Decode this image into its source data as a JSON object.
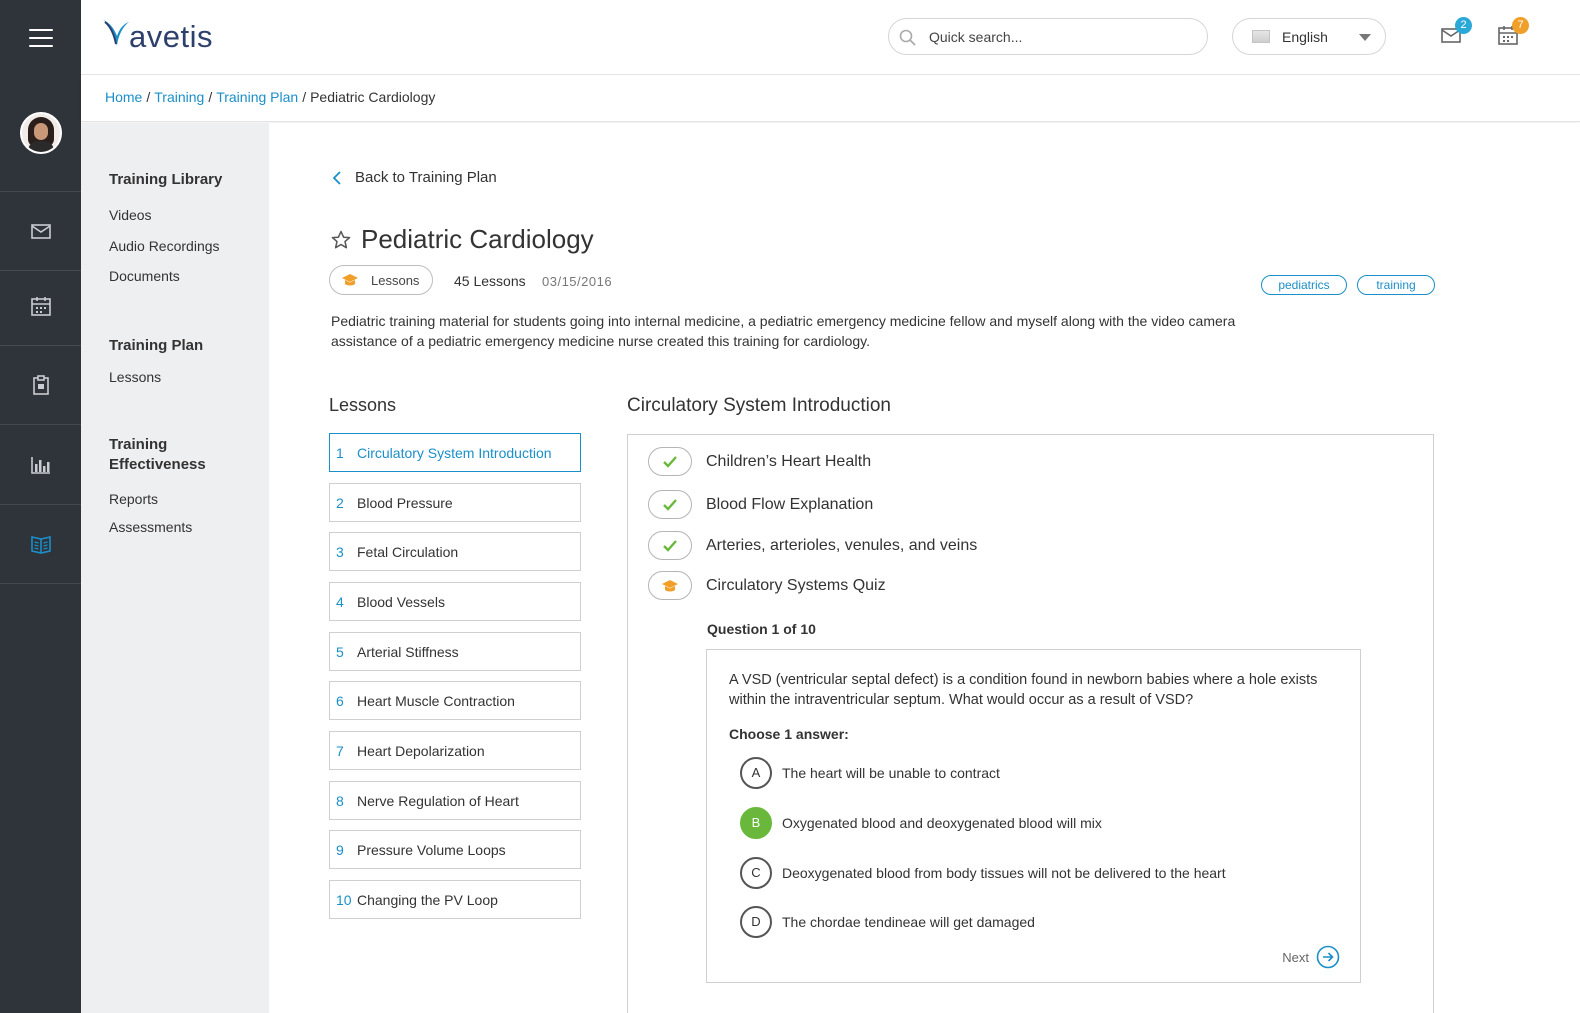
{
  "app": {
    "logo_text": "avetis",
    "accent_color": "#1a8fc9",
    "rail_color": "#2f343a"
  },
  "header": {
    "search_placeholder": "Quick search...",
    "language": "English",
    "mail_badge": "2",
    "calendar_badge": "7",
    "mail_badge_color": "#2aa8d8",
    "calendar_badge_color": "#f0a02a"
  },
  "rail": {
    "items": [
      "mail-icon",
      "calendar-icon",
      "clipboard-icon",
      "bar-chart-icon",
      "book-icon"
    ]
  },
  "breadcrumb": {
    "items": [
      "Home",
      "Training",
      "Training Plan"
    ],
    "current": "Pediatric Cardiology"
  },
  "sidebar": {
    "sections": [
      {
        "title": "Training Library",
        "links": [
          "Videos",
          "Audio Recordings",
          "Documents"
        ]
      },
      {
        "title": "Training Plan",
        "links": [
          "Lessons"
        ]
      },
      {
        "title_line1": "Training",
        "title_line2": "Effectiveness",
        "links": [
          "Reports",
          "Assessments"
        ]
      }
    ]
  },
  "course": {
    "back_label": "Back to Training Plan",
    "title": "Pediatric Cardiology",
    "type_label": "Lessons",
    "lesson_count": "45 Lessons",
    "date": "03/15/2016",
    "tags": [
      "pediatrics",
      "training"
    ],
    "description": "Pediatric training material for students going into internal medicine, a pediatric emergency medicine fellow and myself along with the video camera assistance of a pediatric emergency medicine nurse created this training for cardiology."
  },
  "lessons": {
    "heading": "Lessons",
    "items": [
      {
        "num": "1",
        "label": "Circulatory System Introduction"
      },
      {
        "num": "2",
        "label": "Blood Pressure"
      },
      {
        "num": "3",
        "label": "Fetal Circulation"
      },
      {
        "num": "4",
        "label": "Blood Vessels"
      },
      {
        "num": "5",
        "label": "Arterial Stiffness"
      },
      {
        "num": "6",
        "label": "Heart Muscle Contraction"
      },
      {
        "num": "7",
        "label": "Heart Depolarization"
      },
      {
        "num": "8",
        "label": "Nerve Regulation of Heart"
      },
      {
        "num": "9",
        "label": "Pressure Volume Loops"
      },
      {
        "num": "10",
        "label": "Changing the PV Loop"
      }
    ],
    "active_index": 0
  },
  "lesson_detail": {
    "title": "Circulatory System Introduction",
    "steps": [
      {
        "label": "Children’s Heart Health",
        "status": "complete"
      },
      {
        "label": "Blood Flow Explanation",
        "status": "complete"
      },
      {
        "label": "Arteries, arterioles, venules, and veins",
        "status": "complete"
      },
      {
        "label": "Circulatory Systems Quiz",
        "status": "quiz"
      }
    ],
    "quiz": {
      "progress": "Question 1 of 10",
      "question": "A VSD (ventricular septal defect) is a condition found in newborn babies where a hole exists within the intraventricular septum. What would occur as a result of VSD?",
      "prompt": "Choose 1 answer:",
      "options": [
        {
          "letter": "A",
          "text": "The heart will be unable to contract",
          "selected": false
        },
        {
          "letter": "B",
          "text": "Oxygenated blood and deoxygenated blood will mix",
          "selected": true
        },
        {
          "letter": "C",
          "text": "Deoxygenated blood from body tissues will not be delivered to the heart",
          "selected": false
        },
        {
          "letter": "D",
          "text": "The chordae tendineae will get damaged",
          "selected": false
        }
      ],
      "next_label": "Next"
    }
  }
}
